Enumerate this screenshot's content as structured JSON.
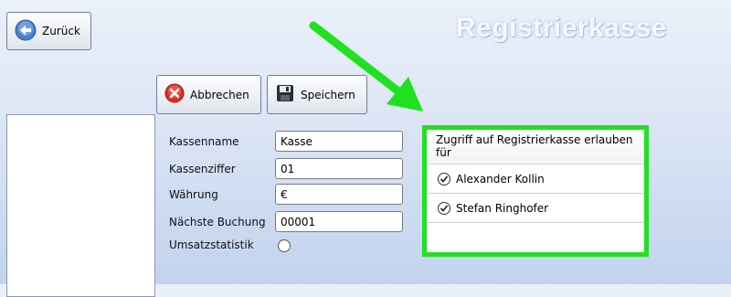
{
  "toolbar": {
    "back_label": "Zurück",
    "cancel_label": "Abbrechen",
    "save_label": "Speichern"
  },
  "app_title": "Registrierkasse",
  "form": {
    "fields": [
      {
        "label": "Kassenname",
        "value": "Kasse"
      },
      {
        "label": "Kassenziffer",
        "value": "01"
      },
      {
        "label": "Währung",
        "value": "€"
      },
      {
        "label": "Nächste Buchung",
        "value": "00001"
      }
    ],
    "umsatz_label": "Umsatzstatistik",
    "umsatz_checked": false
  },
  "access": {
    "header": "Zugriff auf Registrierkasse erlauben für",
    "users": [
      {
        "name": "Alexander Kollin",
        "checked": true
      },
      {
        "name": "Stefan Ringhofer",
        "checked": true
      }
    ]
  },
  "colors": {
    "highlight": "#21e021",
    "background_top": "#ebf1fa",
    "background_bottom": "#c2d3ee"
  },
  "icons": [
    "back-arrow-icon",
    "cancel-x-icon",
    "save-disk-icon",
    "check-icon"
  ]
}
